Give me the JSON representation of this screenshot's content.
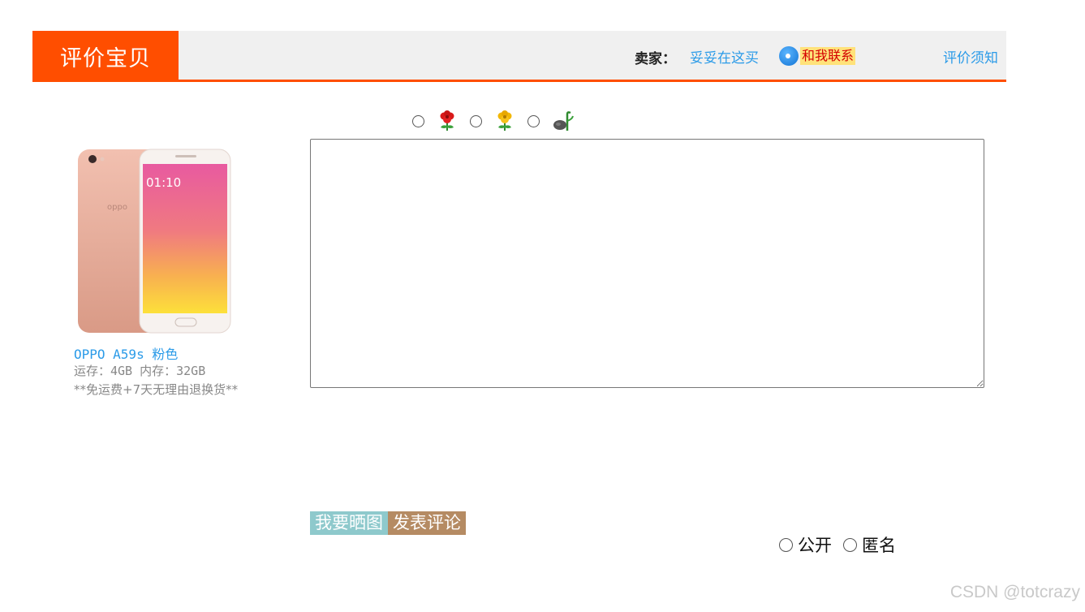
{
  "header": {
    "title": "评价宝贝",
    "seller_label": "卖家：",
    "seller_name": "妥妥在这买",
    "contact_label": "和我联系",
    "rules_link": "评价须知",
    "accent_color": "#ff4e00"
  },
  "rating": {
    "options": [
      {
        "icon": "red-flower-icon"
      },
      {
        "icon": "yellow-flower-icon"
      },
      {
        "icon": "wilted-flower-icon"
      }
    ]
  },
  "product": {
    "name": "OPPO A59s 粉色",
    "spec": "运存：4GB 内存：32GB",
    "promo": "**免运费+7天无理由退换货**",
    "image_icon": "pink-smartphone-image"
  },
  "comment": {
    "value": "",
    "placeholder": ""
  },
  "actions": {
    "upload_label": "我要晒图",
    "submit_label": "发表评论"
  },
  "privacy": {
    "public_label": "公开",
    "anonymous_label": "匿名"
  },
  "watermark": "CSDN @totcrazy"
}
